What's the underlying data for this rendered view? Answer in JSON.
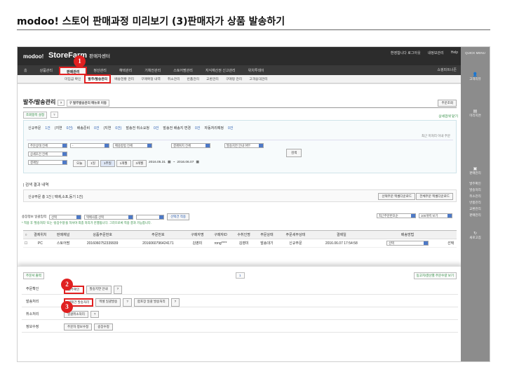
{
  "doc": {
    "title": "modoo! 스토어 판매과정 미리보기 (3)판매자가 상품 발송하기"
  },
  "header": {
    "logo": "modoo!",
    "app_title": "StoreFarm",
    "app_sub": "판매자센터",
    "links": [
      "환영합니다 로그아웃",
      "내정보관리",
      "Help"
    ],
    "shop_link": "쇼핑파트너존"
  },
  "menu": [
    {
      "label": "홈",
      "active": false
    },
    {
      "label": "상품관리",
      "active": false
    },
    {
      "label": "판매관리",
      "active": true
    },
    {
      "label": "정산관리",
      "active": false
    },
    {
      "label": "혜택관리",
      "active": false
    },
    {
      "label": "기획전관리",
      "active": false
    },
    {
      "label": "스토어팜관리",
      "active": false
    },
    {
      "label": "지식재산권 신고관리",
      "active": false
    },
    {
      "label": "위치투데이",
      "active": false
    }
  ],
  "submenu": [
    {
      "label": "미입금 확인",
      "active": false
    },
    {
      "label": "발주/발송관리",
      "active": true
    },
    {
      "label": "배송현황 관리",
      "active": false
    },
    {
      "label": "구매확정 내역",
      "active": false
    },
    {
      "label": "취소관리",
      "active": false
    },
    {
      "label": "반품관리",
      "active": false
    },
    {
      "label": "교환관리",
      "active": false
    },
    {
      "label": "구매평 관리",
      "active": false
    },
    {
      "label": "고객응대관리",
      "active": false
    }
  ],
  "quick": {
    "title": "QUICK MENU",
    "items": [
      "고객리뷰",
      "미리지면",
      "판매관리"
    ],
    "subitems": [
      "발주확인",
      "발송처리",
      "취소관리",
      "반품관리",
      "교환관리",
      "판매관리"
    ],
    "bottom": "새로고침"
  },
  "page": {
    "title": "발주/발송관리",
    "help": "?",
    "old_link": "구 발주발송관리 메뉴로 이동",
    "pref_btn": "주문조회",
    "filter_tag": "조회항목 설정",
    "detail_toggle": "상세검색 닫기",
    "stats": [
      {
        "label": "신규주문",
        "value": "1건"
      },
      {
        "label": "(지연",
        "value": "0건)"
      },
      {
        "label": "배송준비",
        "value": "0건"
      },
      {
        "label": "(지연",
        "value": "0건)"
      },
      {
        "label": "발송전 취소요청",
        "value": "0건"
      },
      {
        "label": "발송전 배송지 변경",
        "value": "0건"
      },
      {
        "label": "자동처리예정",
        "value": "0건"
      }
    ],
    "refresh_note": "최근 미처리 이내 주문",
    "filters": {
      "f1": "주문상태 전체",
      "f2": "-",
      "f3": "배송방법 전체",
      "f4": "결제위치 전체",
      "f5": "발송지연 안내 여부",
      "f6": "상세조건 전체",
      "f7": "결제일"
    },
    "date_chips": [
      "오늘",
      "1일",
      "1주일",
      "1개월",
      "3개월"
    ],
    "date_from": "2016.05.31",
    "date_to": "2016.06.07",
    "search_btn": "검색",
    "result_title": "| 검색 결과 내역",
    "result_summary": "신규주문 총 1건 ( 택배,소포,등기 1건)",
    "excel_sel": "선택주문 엑셀다운로드",
    "excel_all": "전체주문 엑셀다운로드",
    "bulk_label": "송장정보 일괄입력",
    "bulk_sel1": "선택",
    "bulk_sel2": "택배사를 선택",
    "bulk_apply": "선택건 적용",
    "bulk_note": "* 적용 후 '발송처리' 또는 '송장수정'을 하셔야 최종 처리가 진행됩니다. 그러므로써 적용 결과 가능합니다.",
    "sort": "최근주문번호순",
    "page_size": "100개씩 보기"
  },
  "table": {
    "headers": [
      "",
      "결제위치",
      "판매채널",
      "상품주문번호",
      "주문번호",
      "구매자명",
      "구매자ID",
      "수취인명",
      "주문상태",
      "주문세부상태",
      "결제일",
      "배송방법",
      ""
    ],
    "rows": [
      [
        "",
        "PC",
        "스토어팜",
        "2016060752339939",
        "2016060796424171",
        "김영미",
        "rong****",
        "김영미",
        "발송대기",
        "신규주문",
        "2016.06.07 17:54:58",
        "선택",
        "선택"
      ]
    ]
  },
  "bottom": {
    "print_btn": "주문서 출력",
    "page_num": "1",
    "right_btn": "동고지/결산별 주문수량 보기",
    "rows": [
      {
        "label": "주문확인",
        "buttons": [
          "발주확인",
          "발송지연 안내",
          "?"
        ]
      },
      {
        "label": "발송처리",
        "buttons": [
          "선택건 발송처리",
          "엑셀 일괄발송",
          "?",
          "합포장 일괄 발송처리",
          "?"
        ]
      },
      {
        "label": "취소처리",
        "buttons": [
          "일괄취소처리",
          "?"
        ]
      },
      {
        "label": "정보수정",
        "buttons": [
          "주문자 정보수정",
          "송장수정"
        ]
      }
    ]
  },
  "callouts": [
    "1",
    "2",
    "3"
  ],
  "colors": {
    "highlight": "#e02020",
    "topbar": "#2c2c2c",
    "link": "#2a5db0"
  }
}
